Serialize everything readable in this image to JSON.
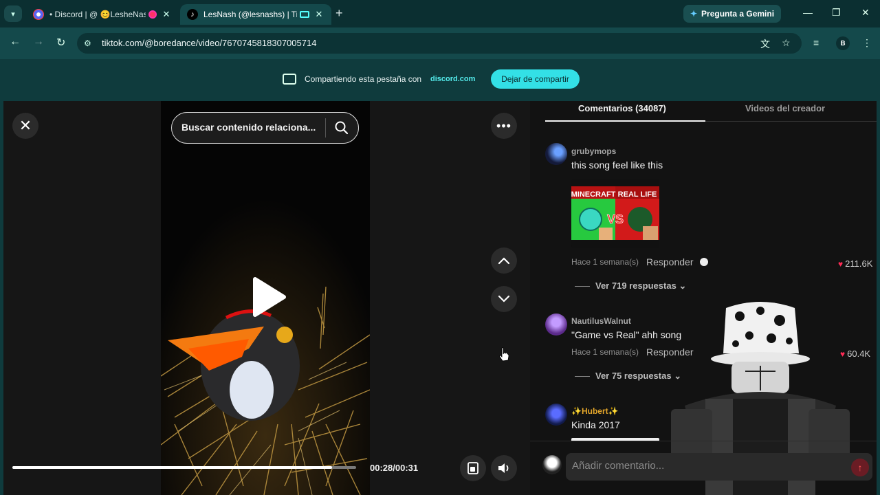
{
  "browser": {
    "tabs": [
      {
        "title": "• Discord | @ 😊LesheNash",
        "favicon": "discord-icon",
        "active": false
      },
      {
        "title": "LesNash (@lesnashs) | TikTok",
        "favicon": "tiktok-icon",
        "active": true
      }
    ],
    "gemini_label": "Pregunta a Gemini",
    "url": "tiktok.com/@boredance/video/7670745818307005714",
    "profile_initial": "B"
  },
  "share_bar": {
    "text": "Compartiendo esta pestaña con",
    "target": "discord.com",
    "stop_label": "Dejar de compartir"
  },
  "player": {
    "search_placeholder": "Buscar contenido relaciona...",
    "time": "00:28/00:31",
    "progress_fraction": 0.93
  },
  "comments_panel": {
    "tab_comments": "Comentarios (34087)",
    "tab_videos": "Videos del creador",
    "comments": [
      {
        "user": "grubymops",
        "text": "this song feel like this",
        "image_labels": [
          "MINECRAFT",
          "REAL LIFE",
          "VS"
        ],
        "time": "Hace 1 semana(s)",
        "reply_label": "Responder",
        "likes": "211.6K",
        "view_replies": "Ver 719 respuestas"
      },
      {
        "user": "NautilusWalnut",
        "text": "\"Game vs Real\" ahh song",
        "time": "Hace 1 semana(s)",
        "reply_label": "Responder",
        "likes": "60.4K",
        "view_replies": "Ver 75 respuestas"
      },
      {
        "user": "✨Hubert✨",
        "text": "Kinda 2017"
      }
    ],
    "input_placeholder": "Añadir comentario..."
  },
  "colors": {
    "browser_frame": "#0f3b3d",
    "share_accent": "#33e0e6",
    "like_heart": "#ff2b55"
  }
}
